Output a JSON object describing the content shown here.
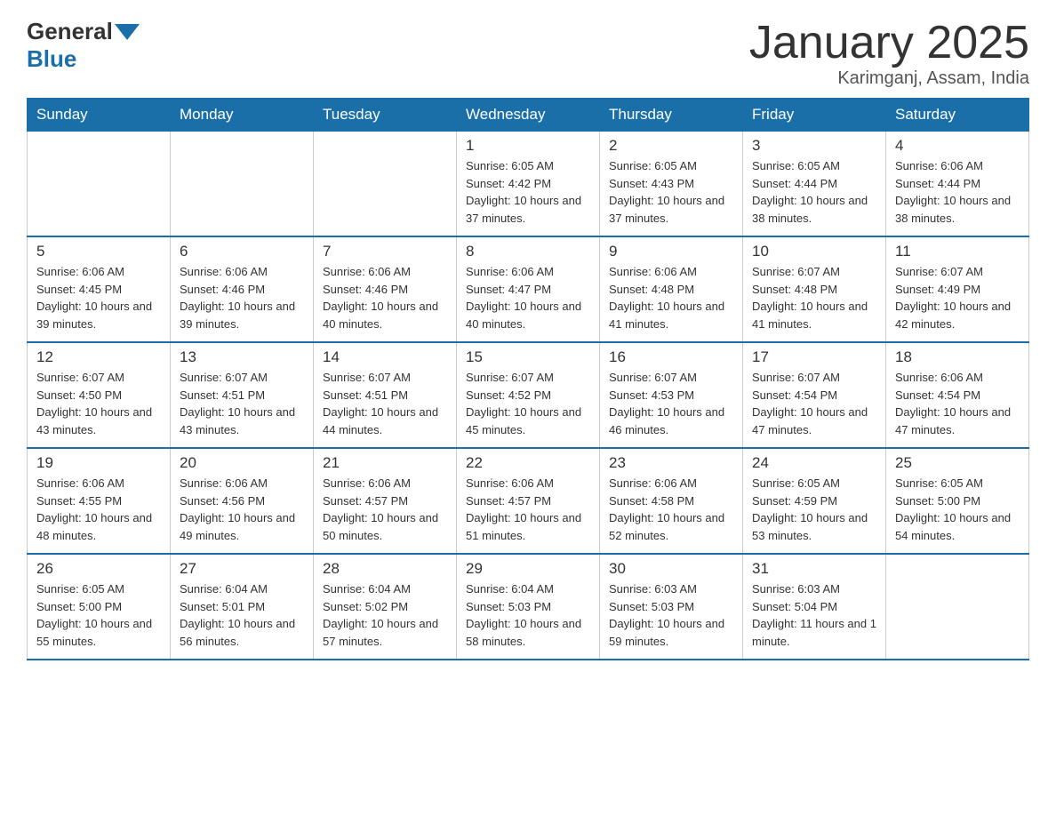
{
  "header": {
    "logo_general": "General",
    "logo_blue": "Blue",
    "title": "January 2025",
    "subtitle": "Karimganj, Assam, India"
  },
  "weekdays": [
    "Sunday",
    "Monday",
    "Tuesday",
    "Wednesday",
    "Thursday",
    "Friday",
    "Saturday"
  ],
  "weeks": [
    [
      {
        "day": "",
        "info": ""
      },
      {
        "day": "",
        "info": ""
      },
      {
        "day": "",
        "info": ""
      },
      {
        "day": "1",
        "info": "Sunrise: 6:05 AM\nSunset: 4:42 PM\nDaylight: 10 hours and 37 minutes."
      },
      {
        "day": "2",
        "info": "Sunrise: 6:05 AM\nSunset: 4:43 PM\nDaylight: 10 hours and 37 minutes."
      },
      {
        "day": "3",
        "info": "Sunrise: 6:05 AM\nSunset: 4:44 PM\nDaylight: 10 hours and 38 minutes."
      },
      {
        "day": "4",
        "info": "Sunrise: 6:06 AM\nSunset: 4:44 PM\nDaylight: 10 hours and 38 minutes."
      }
    ],
    [
      {
        "day": "5",
        "info": "Sunrise: 6:06 AM\nSunset: 4:45 PM\nDaylight: 10 hours and 39 minutes."
      },
      {
        "day": "6",
        "info": "Sunrise: 6:06 AM\nSunset: 4:46 PM\nDaylight: 10 hours and 39 minutes."
      },
      {
        "day": "7",
        "info": "Sunrise: 6:06 AM\nSunset: 4:46 PM\nDaylight: 10 hours and 40 minutes."
      },
      {
        "day": "8",
        "info": "Sunrise: 6:06 AM\nSunset: 4:47 PM\nDaylight: 10 hours and 40 minutes."
      },
      {
        "day": "9",
        "info": "Sunrise: 6:06 AM\nSunset: 4:48 PM\nDaylight: 10 hours and 41 minutes."
      },
      {
        "day": "10",
        "info": "Sunrise: 6:07 AM\nSunset: 4:48 PM\nDaylight: 10 hours and 41 minutes."
      },
      {
        "day": "11",
        "info": "Sunrise: 6:07 AM\nSunset: 4:49 PM\nDaylight: 10 hours and 42 minutes."
      }
    ],
    [
      {
        "day": "12",
        "info": "Sunrise: 6:07 AM\nSunset: 4:50 PM\nDaylight: 10 hours and 43 minutes."
      },
      {
        "day": "13",
        "info": "Sunrise: 6:07 AM\nSunset: 4:51 PM\nDaylight: 10 hours and 43 minutes."
      },
      {
        "day": "14",
        "info": "Sunrise: 6:07 AM\nSunset: 4:51 PM\nDaylight: 10 hours and 44 minutes."
      },
      {
        "day": "15",
        "info": "Sunrise: 6:07 AM\nSunset: 4:52 PM\nDaylight: 10 hours and 45 minutes."
      },
      {
        "day": "16",
        "info": "Sunrise: 6:07 AM\nSunset: 4:53 PM\nDaylight: 10 hours and 46 minutes."
      },
      {
        "day": "17",
        "info": "Sunrise: 6:07 AM\nSunset: 4:54 PM\nDaylight: 10 hours and 47 minutes."
      },
      {
        "day": "18",
        "info": "Sunrise: 6:06 AM\nSunset: 4:54 PM\nDaylight: 10 hours and 47 minutes."
      }
    ],
    [
      {
        "day": "19",
        "info": "Sunrise: 6:06 AM\nSunset: 4:55 PM\nDaylight: 10 hours and 48 minutes."
      },
      {
        "day": "20",
        "info": "Sunrise: 6:06 AM\nSunset: 4:56 PM\nDaylight: 10 hours and 49 minutes."
      },
      {
        "day": "21",
        "info": "Sunrise: 6:06 AM\nSunset: 4:57 PM\nDaylight: 10 hours and 50 minutes."
      },
      {
        "day": "22",
        "info": "Sunrise: 6:06 AM\nSunset: 4:57 PM\nDaylight: 10 hours and 51 minutes."
      },
      {
        "day": "23",
        "info": "Sunrise: 6:06 AM\nSunset: 4:58 PM\nDaylight: 10 hours and 52 minutes."
      },
      {
        "day": "24",
        "info": "Sunrise: 6:05 AM\nSunset: 4:59 PM\nDaylight: 10 hours and 53 minutes."
      },
      {
        "day": "25",
        "info": "Sunrise: 6:05 AM\nSunset: 5:00 PM\nDaylight: 10 hours and 54 minutes."
      }
    ],
    [
      {
        "day": "26",
        "info": "Sunrise: 6:05 AM\nSunset: 5:00 PM\nDaylight: 10 hours and 55 minutes."
      },
      {
        "day": "27",
        "info": "Sunrise: 6:04 AM\nSunset: 5:01 PM\nDaylight: 10 hours and 56 minutes."
      },
      {
        "day": "28",
        "info": "Sunrise: 6:04 AM\nSunset: 5:02 PM\nDaylight: 10 hours and 57 minutes."
      },
      {
        "day": "29",
        "info": "Sunrise: 6:04 AM\nSunset: 5:03 PM\nDaylight: 10 hours and 58 minutes."
      },
      {
        "day": "30",
        "info": "Sunrise: 6:03 AM\nSunset: 5:03 PM\nDaylight: 10 hours and 59 minutes."
      },
      {
        "day": "31",
        "info": "Sunrise: 6:03 AM\nSunset: 5:04 PM\nDaylight: 11 hours and 1 minute."
      },
      {
        "day": "",
        "info": ""
      }
    ]
  ]
}
